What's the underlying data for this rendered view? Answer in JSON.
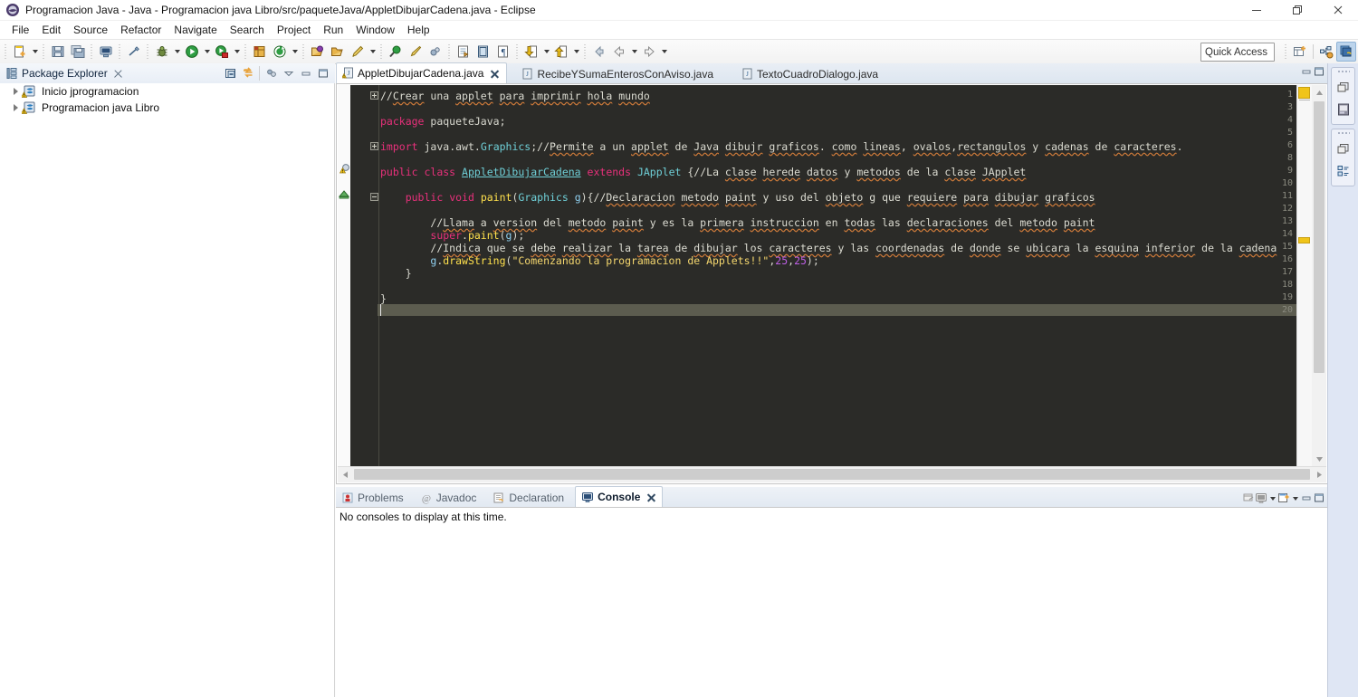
{
  "window": {
    "title": "Programacion Java - Java - Programacion java Libro/src/paqueteJava/AppletDibujarCadena.java - Eclipse",
    "app_icon": "eclipse-icon",
    "controls": [
      {
        "name": "minimize-button",
        "glyph": "minimize-icon"
      },
      {
        "name": "maximize-button",
        "glyph": "restore-icon"
      },
      {
        "name": "close-button",
        "glyph": "close-icon"
      }
    ]
  },
  "menubar": {
    "items": [
      {
        "label": "File"
      },
      {
        "label": "Edit"
      },
      {
        "label": "Source"
      },
      {
        "label": "Refactor"
      },
      {
        "label": "Navigate"
      },
      {
        "label": "Search"
      },
      {
        "label": "Project"
      },
      {
        "label": "Run"
      },
      {
        "label": "Window"
      },
      {
        "label": "Help"
      }
    ]
  },
  "toolbar": {
    "quick_access": {
      "label": "Quick Access",
      "placeholder": "Quick Access"
    },
    "groups": [
      [
        "new-wizard-icon|drop",
        "save-icon",
        "save-all-icon"
      ],
      [
        "print-icon",
        "toggle-breadcrumb-icon"
      ],
      [
        "debug-icon|drop",
        "run-icon|drop",
        "run-coverage-icon|drop"
      ],
      [
        "new-java-project-icon",
        "new-java-package-icon|drop"
      ],
      [
        "open-type-icon",
        "open-task-icon",
        "new-annotation-icon|drop"
      ],
      [
        "search-icon",
        "pin-icon",
        "last-edit-icon"
      ],
      [
        "next-annotation-icon",
        "previous-annotation-icon",
        "pilcrow-icon"
      ],
      [
        "forward-down-icon|drop",
        "back-up-icon|drop"
      ],
      [
        "back-icon",
        "prev-icon|drop",
        "next-icon|drop"
      ]
    ],
    "perspective": [
      "open-perspective-icon",
      "java-browsing-perspective-icon",
      "java-perspective-icon"
    ]
  },
  "package_explorer": {
    "title": "Package Explorer",
    "title_icon": "package-explorer-icon",
    "close_icon": "close-icon",
    "tools": [
      "collapse-all-icon",
      "link-with-editor-icon",
      "view-menu-dots-icon",
      "view-menu-icon",
      "minimize-icon",
      "maximize-icon"
    ],
    "items": [
      {
        "label": "Inicio jprogramacion",
        "icon": "java-project-warning-icon",
        "expanded": false
      },
      {
        "label": "Programacion java Libro",
        "icon": "java-project-warning-icon",
        "expanded": false
      }
    ]
  },
  "editor": {
    "tabs": [
      {
        "label": "AppletDibujarCadena.java",
        "icon": "java-file-warning-icon",
        "active": true,
        "closable": true
      },
      {
        "label": "RecibeYSumaEnterosConAviso.java",
        "icon": "java-file-icon",
        "active": false,
        "closable": false
      },
      {
        "label": "TextoCuadroDialogo.java",
        "icon": "java-file-icon",
        "active": false,
        "closable": false
      }
    ],
    "tab_tools": [
      "minimize-icon",
      "maximize-icon"
    ],
    "theme": {
      "background": "#2b2b28",
      "gutter_text": "#8b8b80",
      "keyword": "#e8307b",
      "type": "#6fd0d8",
      "method": "#ffe14d",
      "string": "#f5d76e",
      "number": "#c060e8",
      "comment": "#dcdcd2",
      "current_line": "#5c5c4f"
    },
    "lines": [
      {
        "num": "1",
        "fold": "plus",
        "text": "//Crear una applet para imprimir hola mundo"
      },
      {
        "num": "3",
        "fold": "",
        "text": ""
      },
      {
        "num": "4",
        "fold": "",
        "text": "package paqueteJava;"
      },
      {
        "num": "5",
        "fold": "",
        "text": ""
      },
      {
        "num": "6",
        "fold": "plus",
        "text": "import java.awt.Graphics;//Permite a un applet de Java dibujr graficos. como lineas, ovalos,rectangulos y cadenas de caracteres."
      },
      {
        "num": "8",
        "fold": "",
        "text": ""
      },
      {
        "num": "9",
        "fold": "",
        "text": "public class AppletDibujarCadena extends JApplet {//La clase herede datos y metodos de la clase JApplet"
      },
      {
        "num": "10",
        "fold": "",
        "text": ""
      },
      {
        "num": "11",
        "fold": "minus",
        "text": "    public void paint(Graphics g){//Declaracion metodo paint y uso del objeto g que requiere para dibujar graficos"
      },
      {
        "num": "12",
        "fold": "",
        "text": ""
      },
      {
        "num": "13",
        "fold": "",
        "text": "        //Llama a version del metodo paint y es la primera instruccion en todas las declaraciones del metodo paint"
      },
      {
        "num": "14",
        "fold": "",
        "text": "        super.paint(g);"
      },
      {
        "num": "15",
        "fold": "",
        "text": "        //Indica que se debe realizar la tarea de dibujar los caracteres y las coordenadas de donde se ubicara la esquina inferior de la cadena"
      },
      {
        "num": "16",
        "fold": "",
        "text": "        g.drawString(\"Comenzando la programacion de Applets!!\",25,25);"
      },
      {
        "num": "17",
        "fold": "",
        "text": "    }"
      },
      {
        "num": "18",
        "fold": "",
        "text": ""
      },
      {
        "num": "19",
        "fold": "",
        "text": "}"
      },
      {
        "num": "20",
        "fold": "",
        "text": ""
      }
    ],
    "current_line_number": "20",
    "gutter_markers": [
      {
        "line": "9",
        "icon": "warning-marker-icon"
      },
      {
        "line": "11",
        "icon": "collapse-marker-icon"
      }
    ],
    "overview_markers": [
      {
        "position_pct": 3,
        "color": "#f0c419"
      },
      {
        "position_pct": 41,
        "color": "#f0c419"
      }
    ]
  },
  "bottom_view": {
    "tabs": [
      {
        "label": "Problems",
        "icon": "problems-icon",
        "active": false
      },
      {
        "label": "Javadoc",
        "icon": "javadoc-icon",
        "active": false
      },
      {
        "label": "Declaration",
        "icon": "declaration-icon",
        "active": false
      },
      {
        "label": "Console",
        "icon": "console-icon",
        "active": true,
        "closable": true
      }
    ],
    "tools": [
      "open-console-icon",
      "display-selected-console-icon",
      "display-dropdown-icon",
      "new-console-view-icon",
      "new-console-dropdown-icon",
      "minimize-icon",
      "maximize-icon"
    ],
    "message": "No consoles to display at this time."
  },
  "right_sidebar": {
    "groups": [
      {
        "icons": [
          "restore-icon",
          "package-explorer-icon"
        ]
      },
      {
        "icons": [
          "restore-icon",
          "outline-icon"
        ]
      }
    ]
  }
}
